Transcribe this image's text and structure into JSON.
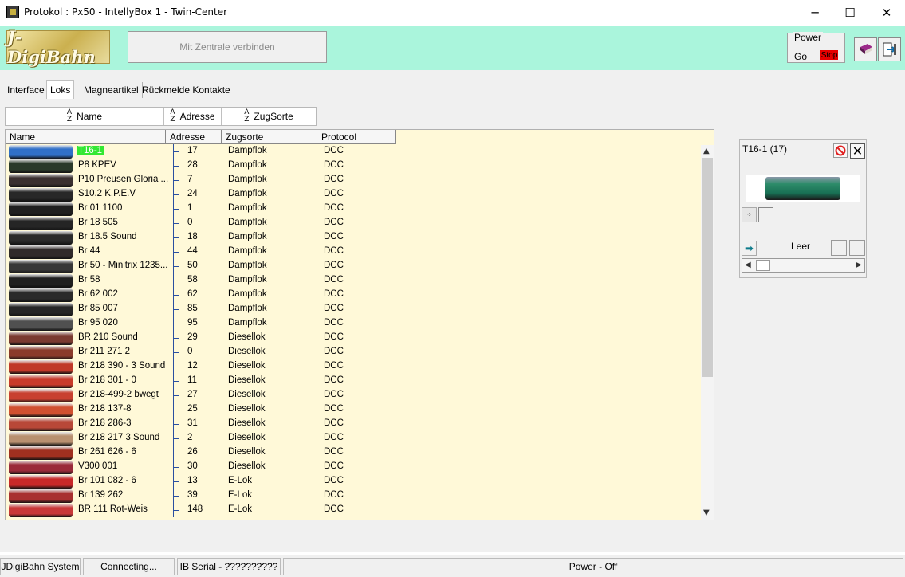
{
  "window": {
    "title": "Protokol : Px50 - IntellyBox 1 - Twin-Center",
    "controls": {
      "minimize": "─",
      "maximize": "☐",
      "close": "✕"
    }
  },
  "header": {
    "logo_text": "J-DigiBahn",
    "connect_label": "Mit Zentrale verbinden",
    "power": {
      "label": "Power",
      "go": "Go",
      "stop": "Stop"
    },
    "colors": {
      "header_bg": "#aaf5dc",
      "stop": "#e60000"
    }
  },
  "tabs": [
    "Interface",
    "Loks",
    "Magneartikel",
    "Rückmelde Kontakte"
  ],
  "active_tab": "Loks",
  "sort_buttons": {
    "name": "Name",
    "address": "Adresse",
    "type": "ZugSorte",
    "icon": "A-Z"
  },
  "columns": {
    "name": "Name",
    "address": "Adresse",
    "type": "Zugsorte",
    "protocol": "Protocol"
  },
  "locos": [
    {
      "name": "T16-1",
      "address": "17",
      "type": "Dampflok",
      "protocol": "DCC",
      "selected": true,
      "color": "#3070c8"
    },
    {
      "name": "P8 KPEV",
      "address": "28",
      "type": "Dampflok",
      "protocol": "DCC",
      "color": "#2a3a2a"
    },
    {
      "name": "P10 Preusen Gloria ...",
      "address": "7",
      "type": "Dampflok",
      "protocol": "DCC",
      "color": "#3a3030"
    },
    {
      "name": "S10.2 K.P.E.V",
      "address": "24",
      "type": "Dampflok",
      "protocol": "DCC",
      "color": "#282828"
    },
    {
      "name": "Br 01 1100",
      "address": "1",
      "type": "Dampflok",
      "protocol": "DCC",
      "color": "#202020"
    },
    {
      "name": "Br 18 505",
      "address": "0",
      "type": "Dampflok",
      "protocol": "DCC",
      "color": "#252525"
    },
    {
      "name": "Br 18.5 Sound",
      "address": "18",
      "type": "Dampflok",
      "protocol": "DCC",
      "color": "#2b2b2b"
    },
    {
      "name": "Br 44",
      "address": "44",
      "type": "Dampflok",
      "protocol": "DCC",
      "color": "#302a2a"
    },
    {
      "name": "Br 50 - Minitrix 1235...",
      "address": "50",
      "type": "Dampflok",
      "protocol": "DCC",
      "color": "#383838"
    },
    {
      "name": "Br 58",
      "address": "58",
      "type": "Dampflok",
      "protocol": "DCC",
      "color": "#202020"
    },
    {
      "name": "Br 62 002",
      "address": "62",
      "type": "Dampflok",
      "protocol": "DCC",
      "color": "#2a2a2a"
    },
    {
      "name": "Br 85 007",
      "address": "85",
      "type": "Dampflok",
      "protocol": "DCC",
      "color": "#262626"
    },
    {
      "name": "Br 95 020",
      "address": "95",
      "type": "Dampflok",
      "protocol": "DCC",
      "color": "#505050"
    },
    {
      "name": "BR 210 Sound",
      "address": "29",
      "type": "Diesellok",
      "protocol": "DCC",
      "color": "#7a3a30"
    },
    {
      "name": "Br 211 271 2",
      "address": "0",
      "type": "Diesellok",
      "protocol": "DCC",
      "color": "#8a3a2a"
    },
    {
      "name": "Br 218 390 - 3 Sound",
      "address": "12",
      "type": "Diesellok",
      "protocol": "DCC",
      "color": "#c03828"
    },
    {
      "name": "Br 218 301 - 0",
      "address": "11",
      "type": "Diesellok",
      "protocol": "DCC",
      "color": "#c83a2a"
    },
    {
      "name": "Br 218-499-2 bwegt",
      "address": "27",
      "type": "Diesellok",
      "protocol": "DCC",
      "color": "#c84030"
    },
    {
      "name": "Br 218 137-8",
      "address": "25",
      "type": "Diesellok",
      "protocol": "DCC",
      "color": "#d05030"
    },
    {
      "name": " Br 218 286-3",
      "address": "31",
      "type": "Diesellok",
      "protocol": "DCC",
      "color": "#b84838"
    },
    {
      "name": "Br 218 217 3 Sound",
      "address": "2",
      "type": "Diesellok",
      "protocol": "DCC",
      "color": "#b89070"
    },
    {
      "name": "Br 261 626 - 6",
      "address": "26",
      "type": "Diesellok",
      "protocol": "DCC",
      "color": "#a03020"
    },
    {
      "name": "V300 001",
      "address": "30",
      "type": "Diesellok",
      "protocol": "DCC",
      "color": "#9a2a3a"
    },
    {
      "name": "Br 101 082 - 6",
      "address": "13",
      "type": "E-Lok",
      "protocol": "DCC",
      "color": "#c82828"
    },
    {
      "name": "Br 139 262",
      "address": "39",
      "type": "E-Lok",
      "protocol": "DCC",
      "color": "#a83030"
    },
    {
      "name": "BR 111  Rot-Weis",
      "address": "148",
      "type": "E-Lok",
      "protocol": "DCC",
      "color": "#c83838"
    }
  ],
  "loco_panel": {
    "title": "T16-1 (17)",
    "function_label": "Leer"
  },
  "status": {
    "system": "JDigiBahn System",
    "connection": "Connecting...",
    "serial": "IB Serial - ??????????",
    "power": "Power - Off"
  }
}
